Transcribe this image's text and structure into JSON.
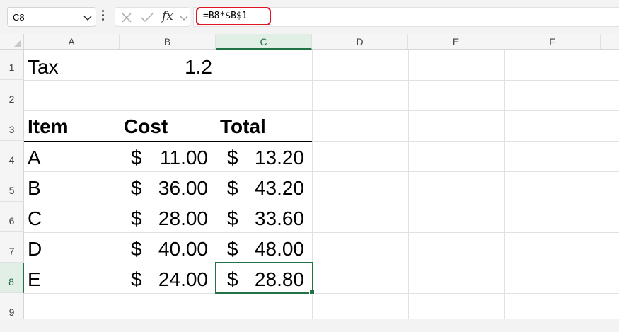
{
  "formula_bar": {
    "name_box": "C8",
    "formula": "=B8*$B$1",
    "icons": [
      "chevron-down-icon",
      "more-vertical-icon",
      "cancel-x-icon",
      "confirm-check-icon",
      "function-fx-icon"
    ],
    "fx_label": "fx"
  },
  "grid": {
    "columns": [
      "A",
      "B",
      "C",
      "D",
      "E",
      "F"
    ],
    "rows": [
      "1",
      "2",
      "3",
      "4",
      "5",
      "6",
      "7",
      "8",
      "9"
    ],
    "selected_cell": "C8",
    "cells": {
      "A1": "Tax",
      "B1": "1.2",
      "A3": "Item",
      "B3": "Cost",
      "C3": "Total",
      "A4": "A",
      "A5": "B",
      "A6": "C",
      "A7": "D",
      "A8": "E",
      "currency": "$",
      "B4": "11.00",
      "B5": "36.00",
      "B6": "28.00",
      "B7": "40.00",
      "B8": "24.00",
      "C4": "13.20",
      "C5": "43.20",
      "C6": "33.60",
      "C7": "48.00",
      "C8": "28.80"
    },
    "accent_color": "#217346",
    "highlight_color": "#e0141e"
  }
}
